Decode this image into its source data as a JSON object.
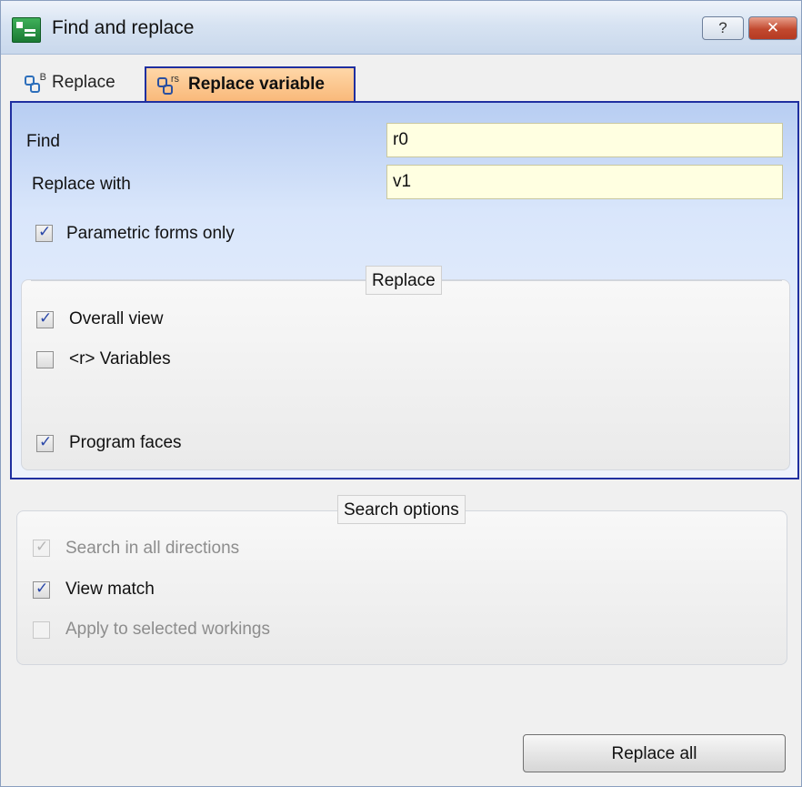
{
  "window": {
    "title": "Find and replace"
  },
  "titlebar_buttons": {
    "help": "?",
    "close": "✕"
  },
  "tabs": [
    {
      "label": "Replace",
      "active": false
    },
    {
      "label": "Replace variable",
      "active": true
    }
  ],
  "form": {
    "find_label": "Find",
    "find_value": "r0",
    "replace_label": "Replace with",
    "replace_value": "v1",
    "parametric_label": "Parametric forms only",
    "parametric_checked": true
  },
  "replace_group": {
    "caption": "Replace",
    "options": [
      {
        "label": "Overall view",
        "checked": true
      },
      {
        "label": "<r> Variables",
        "checked": false
      },
      {
        "label": "Program faces",
        "checked": true
      }
    ]
  },
  "search_group": {
    "caption": "Search options",
    "options": [
      {
        "label": "Search in all directions",
        "checked": true,
        "enabled": false
      },
      {
        "label": "View match",
        "checked": true,
        "enabled": true
      },
      {
        "label": "Apply to selected workings",
        "checked": false,
        "enabled": false
      }
    ]
  },
  "footer": {
    "replace_all_label": "Replace all"
  },
  "colors": {
    "active_tab": "#f9b97a",
    "panel_border": "#1f2fa0",
    "input_bg": "#ffffe1"
  }
}
